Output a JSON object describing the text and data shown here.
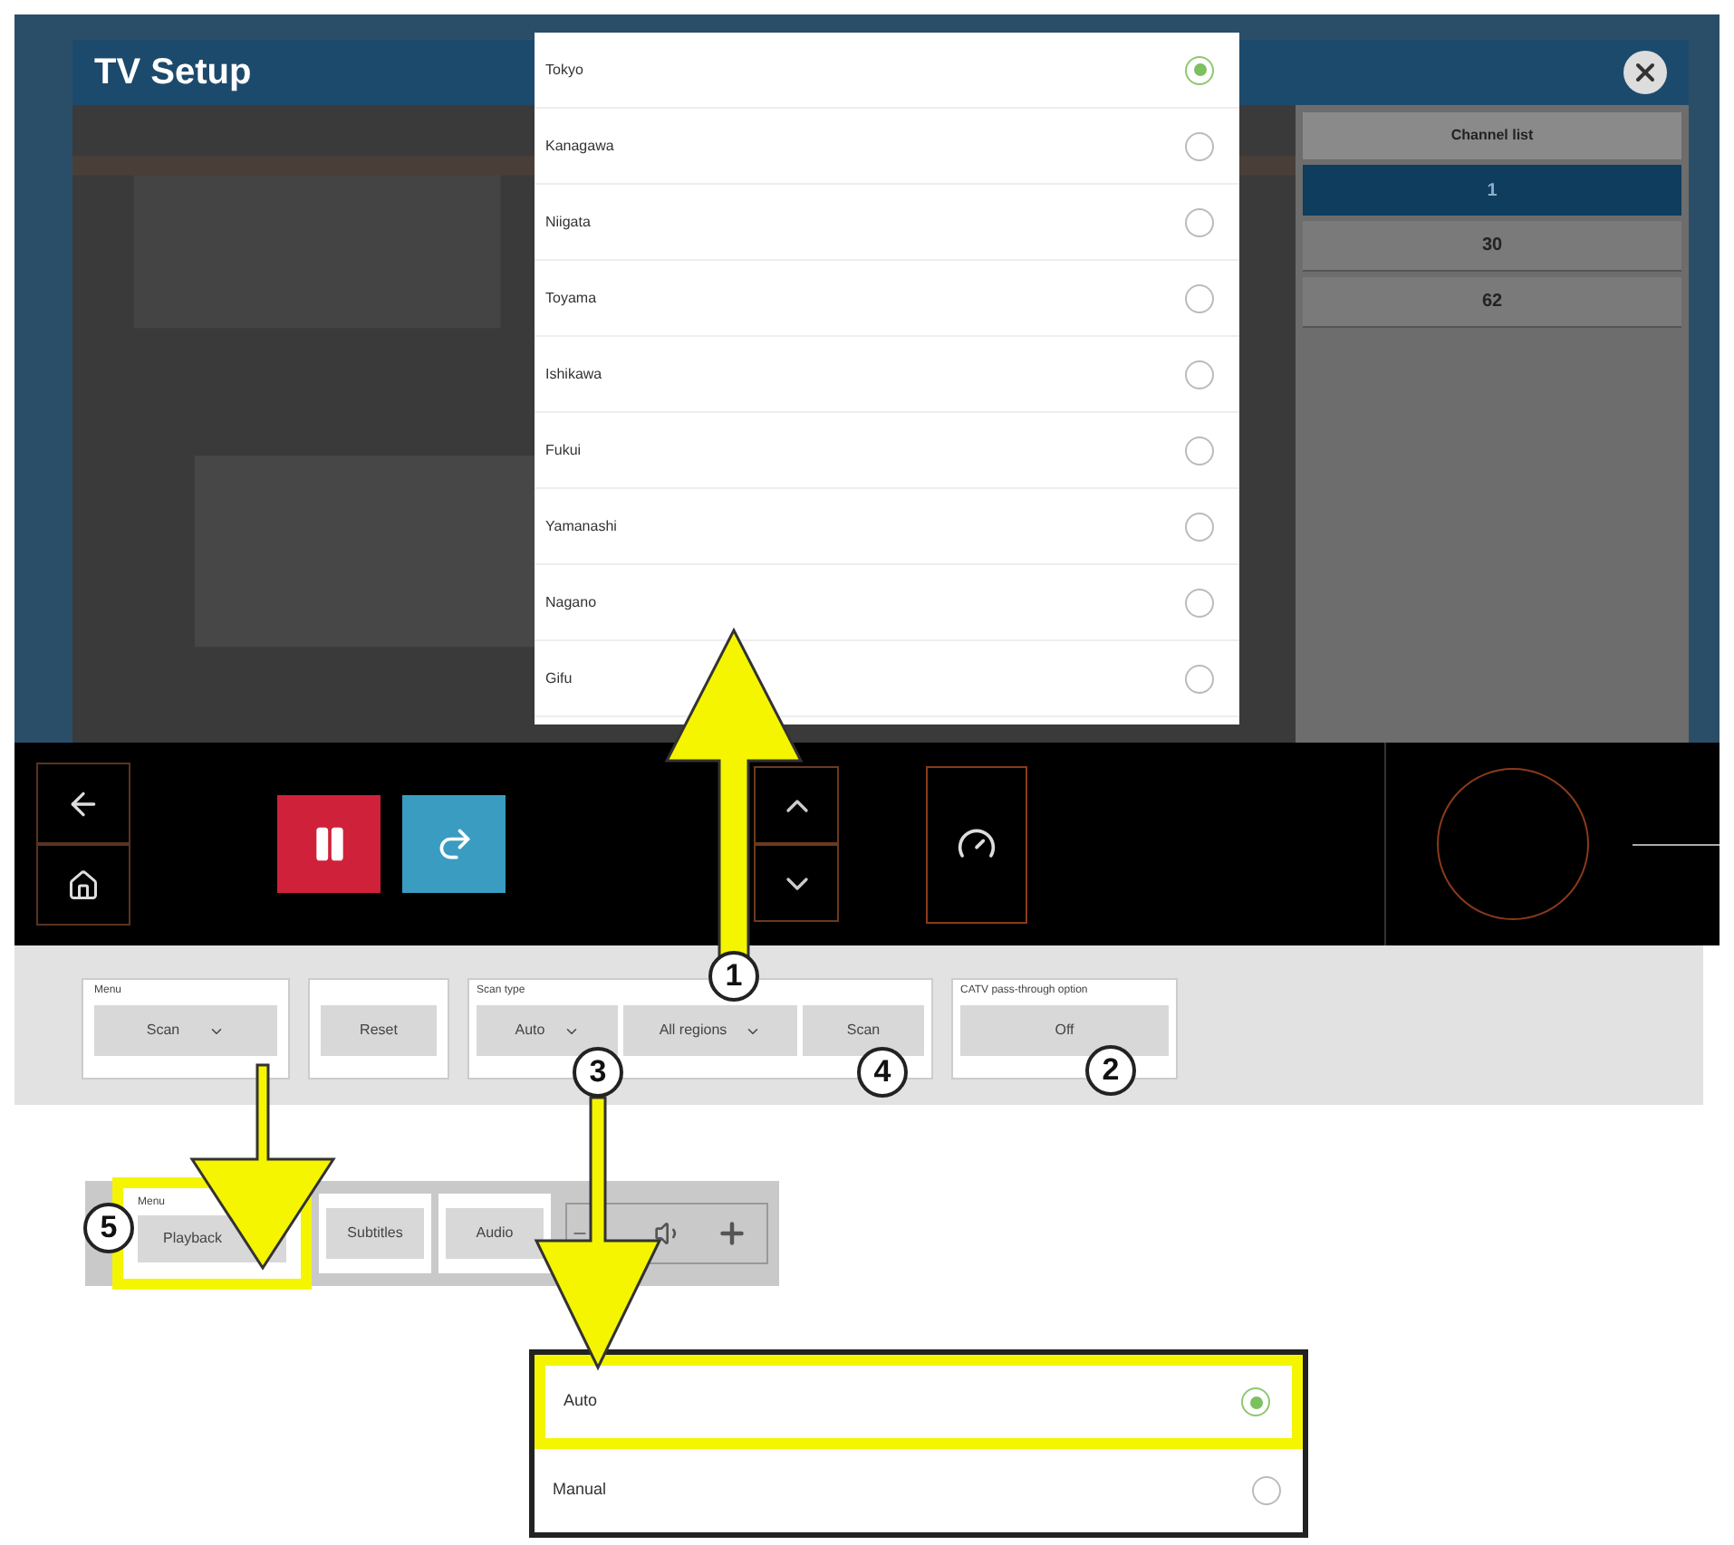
{
  "window": {
    "title": "TV Setup"
  },
  "channel_list": {
    "header": "Channel list",
    "rows": [
      {
        "number": "1",
        "selected": true
      },
      {
        "number": "30",
        "selected": false
      },
      {
        "number": "62",
        "selected": false
      }
    ]
  },
  "region_dropdown": {
    "options": [
      {
        "label": "Tokyo",
        "selected": true
      },
      {
        "label": "Kanagawa",
        "selected": false
      },
      {
        "label": "Niigata",
        "selected": false
      },
      {
        "label": "Toyama",
        "selected": false
      },
      {
        "label": "Ishikawa",
        "selected": false
      },
      {
        "label": "Fukui",
        "selected": false
      },
      {
        "label": "Yamanashi",
        "selected": false
      },
      {
        "label": "Nagano",
        "selected": false
      },
      {
        "label": "Gifu",
        "selected": false
      }
    ]
  },
  "scan_toolbar": {
    "menu": {
      "label": "Menu",
      "value": "Scan"
    },
    "reset": "Reset",
    "scan_type": {
      "label": "Scan type",
      "mode": "Auto",
      "region": "All regions",
      "scan_button": "Scan"
    },
    "catv": {
      "label": "CATV pass-through option",
      "value": "Off"
    }
  },
  "playback_toolbar": {
    "menu": {
      "label": "Menu",
      "value": "Playback",
      "highlighted": true
    },
    "buttons": [
      "Subtitles",
      "Audio"
    ]
  },
  "scan_mode_dropdown": {
    "options": [
      {
        "label": "Auto",
        "selected": true,
        "highlighted": true
      },
      {
        "label": "Manual",
        "selected": false,
        "highlighted": false
      }
    ]
  },
  "callouts": [
    "1",
    "3",
    "4",
    "2",
    "5"
  ]
}
